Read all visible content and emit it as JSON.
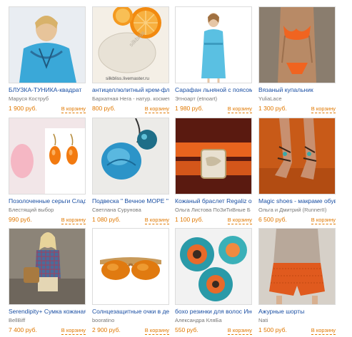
{
  "products": [
    {
      "title": "БЛУЗКА-ТУНИКА-квадрат",
      "seller": "Маруся Коструб",
      "price": "1 900 руб.",
      "cart": "В корзину"
    },
    {
      "title": "антицеллюлитный крем-фл",
      "seller": "Бархатная Нега - натур. космет",
      "price": "800 руб.",
      "cart": "В корзину",
      "watermark": "silkbliss",
      "watermark_url": "silkbliss.livemaster.ru"
    },
    {
      "title": "Сарафан льняной с поясом",
      "seller": "Этноарт (etnoart)",
      "price": "1 980 руб.",
      "cart": "В корзину"
    },
    {
      "title": "Вязаный купальник",
      "seller": "YuliaLace",
      "price": "1 300 руб.",
      "cart": "В корзину"
    },
    {
      "title": "Позолоченные серьги Слад",
      "seller": "Блестящий выбор",
      "price": "990 руб.",
      "cart": "В корзину"
    },
    {
      "title": "Подвеска \" Вечное МОРЕ \"",
      "seller": "Светлана Сурунова",
      "price": "1 080 руб.",
      "cart": "В корзину"
    },
    {
      "title": "Кожаный браслет Regaliz ор",
      "seller": "Ольга Листова ПоЗиТиВные Б",
      "price": "1 100 руб.",
      "cart": "В корзину"
    },
    {
      "title": "Magic shoes - макраме обув",
      "seller": "Ольга и Дмитрий (RunnerII)",
      "price": "6 500 руб.",
      "cart": "В корзину"
    },
    {
      "title": "Serendipity+ Сумка кожаная",
      "seller": "BellBiff",
      "price": "7 400 руб.",
      "cart": "В корзину"
    },
    {
      "title": "Солнцезащитные очки в дер",
      "seller": "booratino",
      "price": "2 900 руб.",
      "cart": "В корзину"
    },
    {
      "title": "бохо резинки для волос Иног",
      "seller": "Александра КляБа",
      "price": "550 руб.",
      "cart": "В корзину"
    },
    {
      "title": "Ажурные шорты",
      "seller": "Nati",
      "price": "1 500 руб.",
      "cart": "В корзину"
    }
  ],
  "colors": {
    "title": "#1a4fa3",
    "price": "#e07800",
    "seller": "#777777"
  }
}
